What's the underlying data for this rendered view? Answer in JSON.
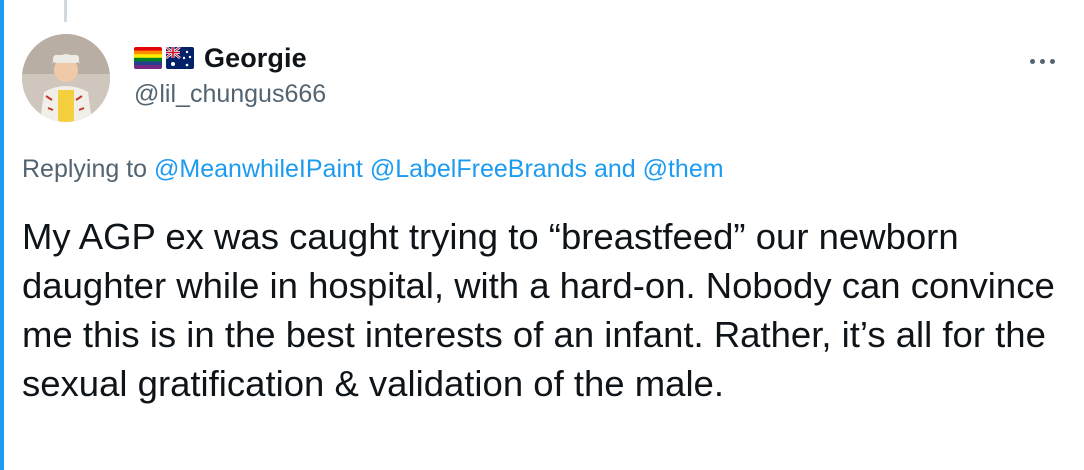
{
  "tweet": {
    "display_name": "Georgie",
    "handle": "@lil_chungus666",
    "more_icon": "more-horizontal-icon",
    "flags": [
      "rainbow-pride-flag",
      "australian-flag"
    ],
    "replying_prefix": "Replying to",
    "replying_mention_1": "@MeanwhileIPaint",
    "replying_mention_2": "@LabelFreeBrands",
    "replying_and": "and",
    "replying_mention_3": "@them",
    "text": "My AGP ex was caught trying to “breastfeed” our newborn daughter while in hospital, with a hard-on. Nobody can convince me this is in the best interests of an infant. Rather, it’s all for the sexual gratification & validation of the male."
  },
  "colors": {
    "accent": "#1d9bf0",
    "text": "#0f1419",
    "secondary": "#536471",
    "thread_line": "#cfd9de"
  }
}
